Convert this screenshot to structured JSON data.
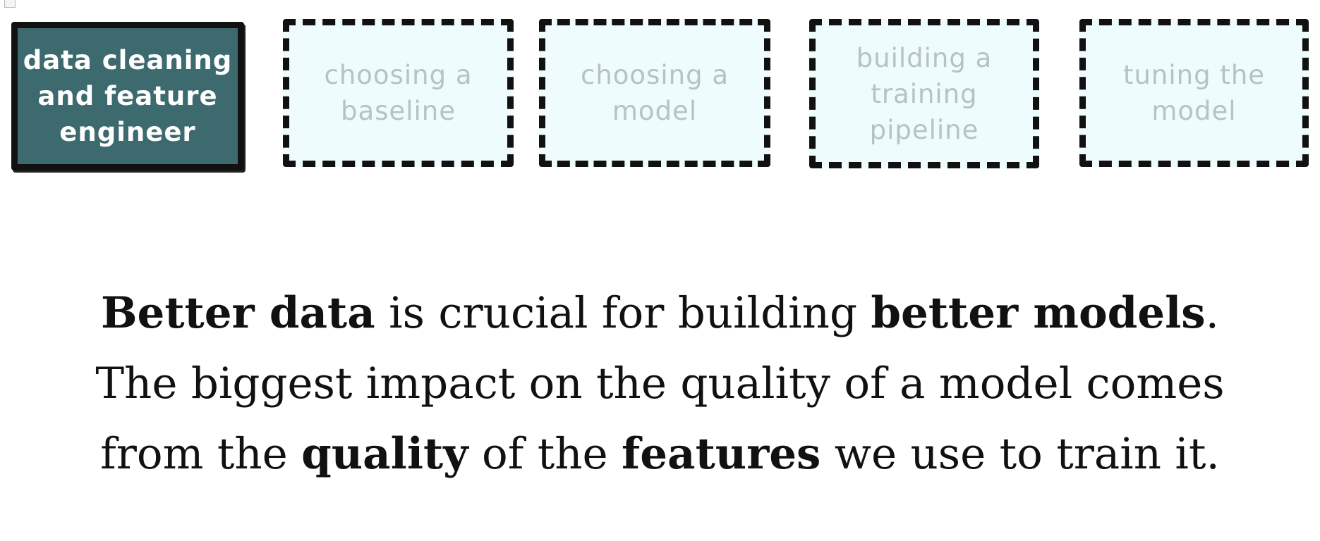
{
  "steps": [
    {
      "label": "data cleaning\nand feature\nengineer",
      "state": "active"
    },
    {
      "label": "choosing a\nbaseline",
      "state": "inactive"
    },
    {
      "label": "choosing a\nmodel",
      "state": "inactive"
    },
    {
      "label": "building a\ntraining\npipeline",
      "state": "inactive"
    },
    {
      "label": "tuning the\nmodel",
      "state": "inactive"
    }
  ],
  "message": {
    "line1": {
      "b1": "Better data",
      "t1": " is crucial for building ",
      "b2": "better models",
      "t2": "."
    },
    "line2": {
      "t1": "The biggest impact on the quality of a model comes"
    },
    "line3": {
      "t1": "from the ",
      "b1": "quality",
      "t2": " of the ",
      "b2": "features",
      "t3": " we use to train it."
    }
  },
  "colors": {
    "active_fill": "#3c6a6e",
    "inactive_fill": "#eefcfd",
    "inactive_text": "#b6c2c4",
    "border": "#111111"
  }
}
